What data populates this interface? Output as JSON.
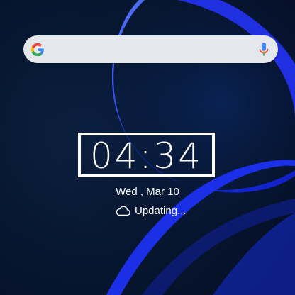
{
  "search": {
    "logo_icon": "google-g-icon",
    "mic_icon": "microphone-icon"
  },
  "clock": {
    "time": "04:34"
  },
  "date": {
    "text": "Wed , Mar 10"
  },
  "weather": {
    "icon": "cloud-icon",
    "status": "Updating..."
  },
  "colors": {
    "background": "#061027",
    "accent_blue": "#1f3cff",
    "text": "#ffffff",
    "search_bar": "#e4e7ec"
  }
}
